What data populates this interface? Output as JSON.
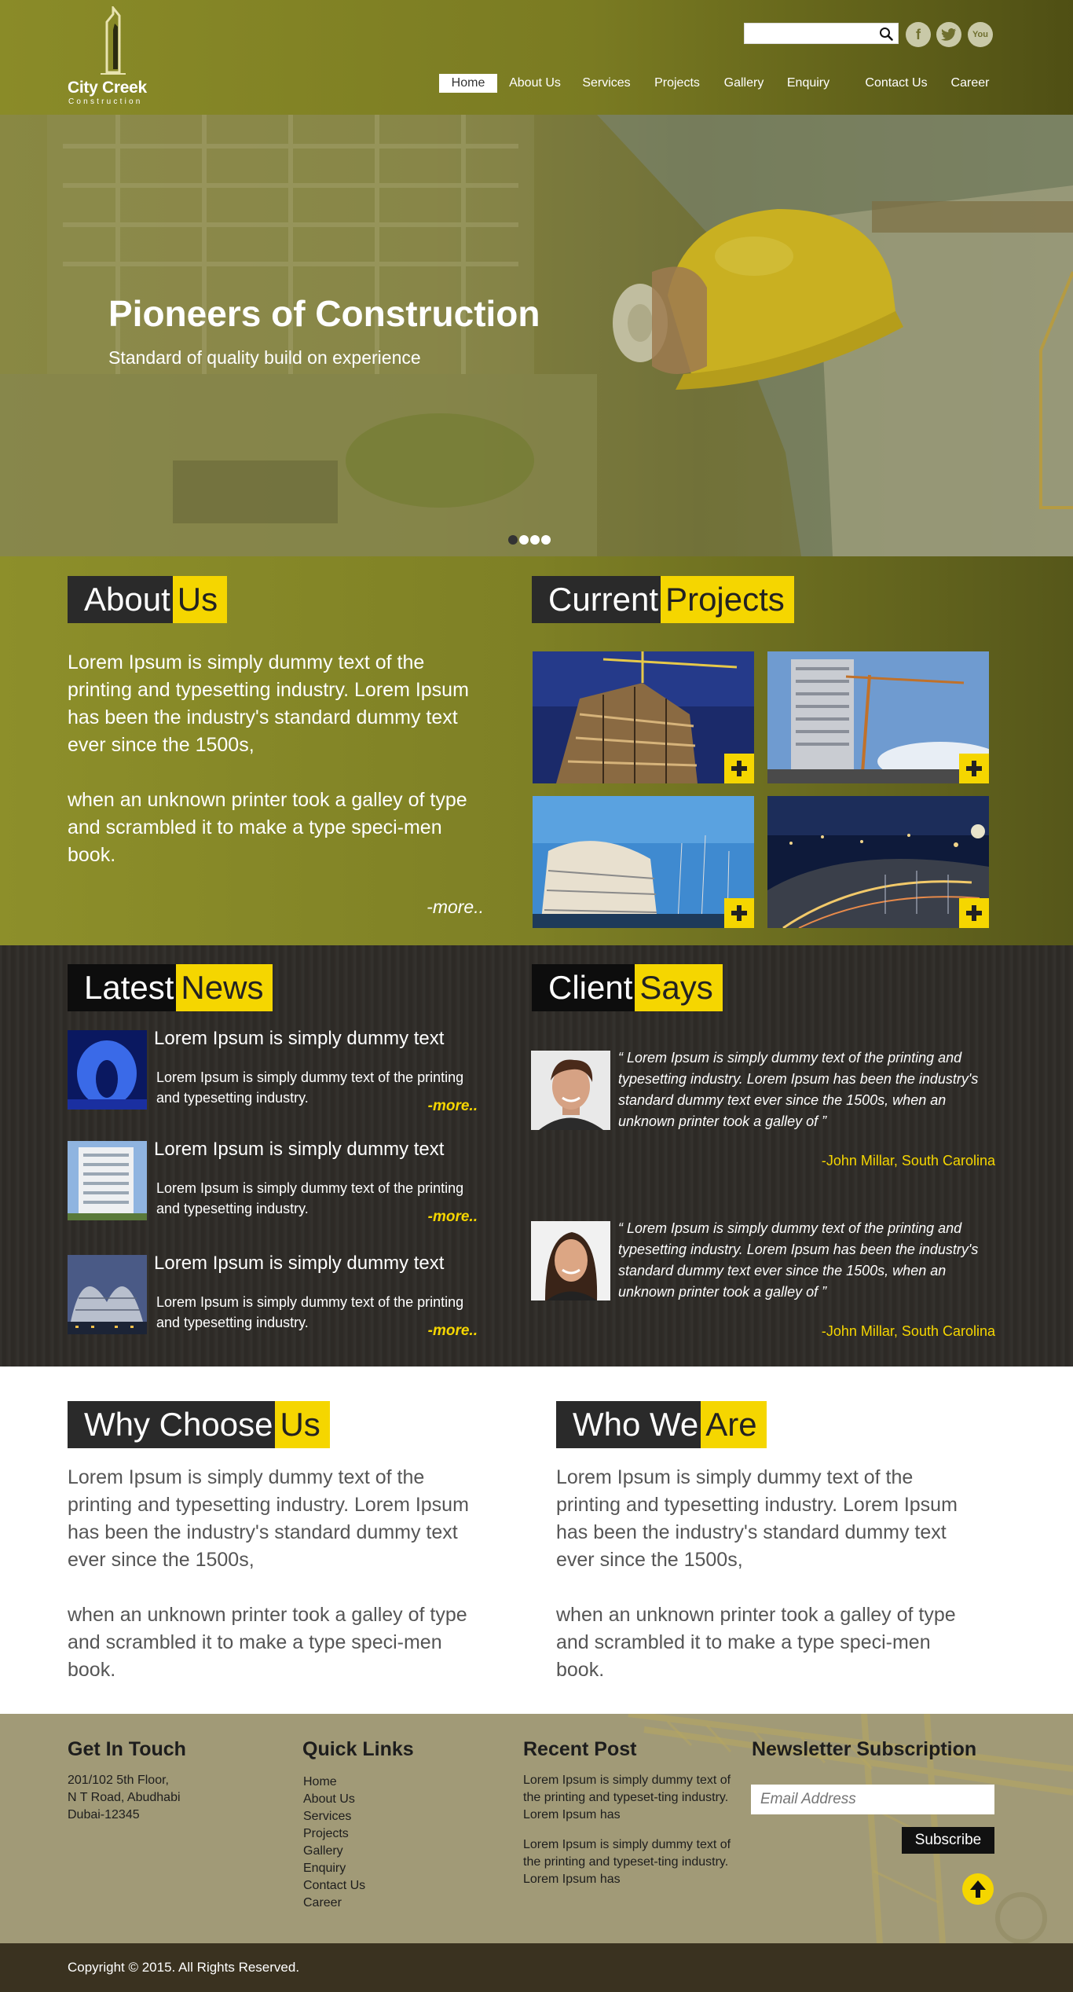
{
  "brand": {
    "name": "City Creek",
    "tagline": "Construction"
  },
  "header": {
    "search_placeholder": "",
    "social": [
      "facebook-icon",
      "twitter-icon",
      "youtube-icon"
    ],
    "youtube_label": "You"
  },
  "nav": {
    "items": [
      {
        "label": "Home",
        "active": true
      },
      {
        "label": "About Us"
      },
      {
        "label": "Services"
      },
      {
        "label": "Projects"
      },
      {
        "label": "Gallery"
      },
      {
        "label": "Enquiry"
      },
      {
        "label": "Contact Us"
      },
      {
        "label": "Career"
      }
    ]
  },
  "hero": {
    "title": "Pioneers of Construction",
    "subtitle": "Standard of quality build on experience",
    "slides": 4,
    "active_slide": 1
  },
  "about": {
    "heading_dark": "About",
    "heading_yellow": "Us",
    "paragraphs": [
      "Lorem Ipsum is simply dummy text of the printing and typesetting industry. Lorem Ipsum has been the industry's standard dummy text ever since the 1500s,",
      "when an unknown printer took a galley of type and scrambled it to make a type speci-men book."
    ],
    "more": "-more.."
  },
  "projects": {
    "heading_dark": "Current",
    "heading_yellow": "Projects",
    "items": [
      "project-1",
      "project-2",
      "project-3",
      "project-4"
    ]
  },
  "news": {
    "heading_dark": "Latest",
    "heading_yellow": "News",
    "items": [
      {
        "title": "Lorem Ipsum is simply dummy text",
        "desc": "Lorem Ipsum is simply dummy text of the printing and typesetting industry.",
        "more": "-more.."
      },
      {
        "title": "Lorem Ipsum is simply dummy text",
        "desc": "Lorem Ipsum is simply dummy text of the printing and typesetting industry.",
        "more": "-more.."
      },
      {
        "title": "Lorem Ipsum is simply dummy text",
        "desc": "Lorem Ipsum is simply dummy text of the printing and typesetting industry.",
        "more": "-more.."
      }
    ]
  },
  "clients": {
    "heading_dark": "Client",
    "heading_yellow": "Says",
    "items": [
      {
        "quote": "“ Lorem Ipsum is simply dummy text of the printing and typesetting industry. Lorem Ipsum has been the industry's standard dummy text ever since the 1500s, when an unknown printer took a galley of ”",
        "author": "-John Millar, South Carolina"
      },
      {
        "quote": "“ Lorem Ipsum is simply dummy text of the printing and typesetting industry. Lorem Ipsum has been the industry's standard dummy text ever since the 1500s, when an unknown printer took a galley of ”",
        "author": "-John Millar, South Carolina"
      }
    ]
  },
  "why": {
    "heading_dark": "Why Choose",
    "heading_yellow": "Us",
    "paragraphs": [
      "Lorem Ipsum is simply dummy text of the printing and typesetting industry. Lorem Ipsum has been the industry's standard dummy text ever since the 1500s,",
      "when an unknown printer took a galley of type and scrambled it to make a type speci-men book."
    ]
  },
  "who": {
    "heading_dark": "Who We",
    "heading_yellow": "Are",
    "paragraphs": [
      "Lorem Ipsum is simply dummy text of the printing and typesetting industry. Lorem Ipsum has been the industry's standard dummy text ever since the 1500s,",
      "when an unknown printer took a galley of type and scrambled it to make a type speci-men book."
    ]
  },
  "footer": {
    "contact": {
      "heading": "Get In Touch",
      "lines": [
        "201/102 5th Floor,",
        "N T Road, Abudhabi",
        "Dubai-12345"
      ]
    },
    "links": {
      "heading": "Quick Links",
      "items": [
        "Home",
        "About Us",
        "Services",
        "Projects",
        "Gallery",
        "Enquiry",
        "Contact Us",
        "Career"
      ]
    },
    "recent": {
      "heading": "Recent Post",
      "posts": [
        "Lorem Ipsum is simply dummy text of the printing and typeset-ting industry. Lorem Ipsum has",
        "Lorem Ipsum is simply dummy text of the printing and typeset-ting industry. Lorem Ipsum has"
      ]
    },
    "newsletter": {
      "heading": "Newsletter Subscription",
      "placeholder": "Email Address",
      "button": "Subscribe"
    },
    "copyright": "Copyright © 2015. All Rights Reserved."
  },
  "colors": {
    "olive": "#8a8b28",
    "dark_olive": "#4f4f14",
    "yellow": "#f5d600",
    "charcoal": "#2a2a2a",
    "footer": "#a19a77"
  }
}
